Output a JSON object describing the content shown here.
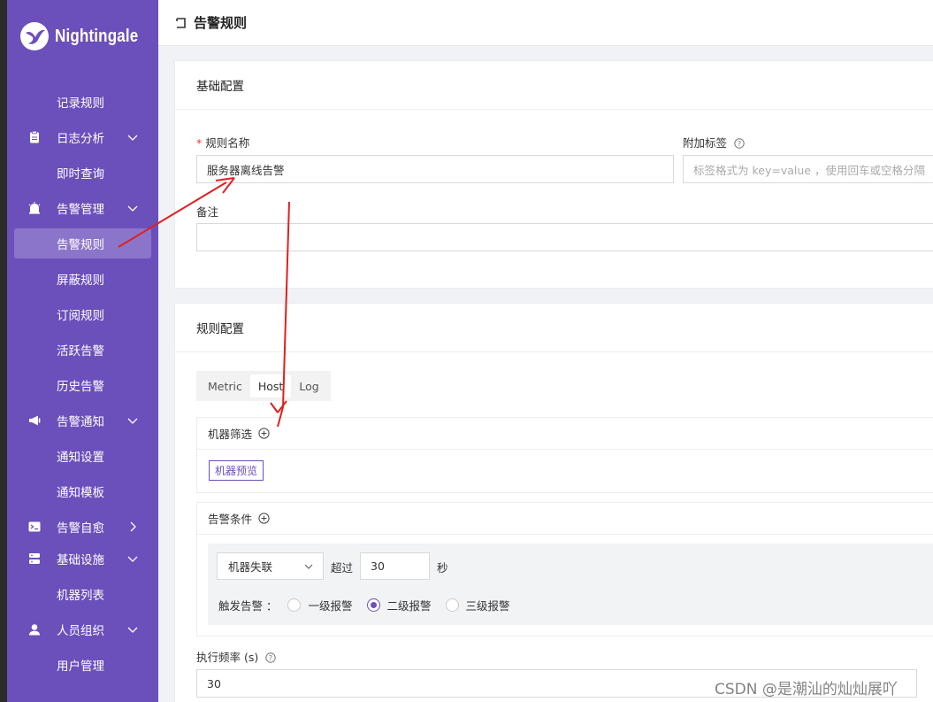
{
  "brand": {
    "name": "Nightingale"
  },
  "sidebar": {
    "items": [
      {
        "label": "记录规则",
        "kind": "child"
      },
      {
        "label": "日志分析",
        "kind": "group",
        "icon": "clipboard-icon",
        "caret": "down"
      },
      {
        "label": "即时查询",
        "kind": "child"
      },
      {
        "label": "告警管理",
        "kind": "group",
        "icon": "alarm-bell-icon",
        "caret": "down"
      },
      {
        "label": "告警规则",
        "kind": "child",
        "active": true
      },
      {
        "label": "屏蔽规则",
        "kind": "child"
      },
      {
        "label": "订阅规则",
        "kind": "child"
      },
      {
        "label": "活跃告警",
        "kind": "child"
      },
      {
        "label": "历史告警",
        "kind": "child"
      },
      {
        "label": "告警通知",
        "kind": "group",
        "icon": "megaphone-icon",
        "caret": "down"
      },
      {
        "label": "通知设置",
        "kind": "child"
      },
      {
        "label": "通知模板",
        "kind": "child"
      },
      {
        "label": "告警自愈",
        "kind": "group",
        "icon": "terminal-icon",
        "caret": "right"
      },
      {
        "label": "基础设施",
        "kind": "group",
        "icon": "server-icon",
        "caret": "down"
      },
      {
        "label": "机器列表",
        "kind": "child"
      },
      {
        "label": "人员组织",
        "kind": "group",
        "icon": "user-icon",
        "caret": "down"
      },
      {
        "label": "用户管理",
        "kind": "child"
      }
    ]
  },
  "header": {
    "title": "告警规则"
  },
  "basic": {
    "section_title": "基础配置",
    "rule_name_label": "规则名称",
    "rule_name_value": "服务器离线告警",
    "tags_label": "附加标签",
    "tags_placeholder": "标签格式为 key=value ，使用回车或空格分隔",
    "note_label": "备注",
    "note_value": ""
  },
  "rule": {
    "section_title": "规则配置",
    "tabs": [
      {
        "label": "Metric"
      },
      {
        "label": "Host",
        "active": true
      },
      {
        "label": "Log"
      }
    ],
    "machine_filter_label": "机器筛选",
    "machine_preview_button": "机器预览",
    "alert_condition_label": "告警条件",
    "condition_select_value": "机器失联",
    "exceed_label": "超过",
    "exceed_value": "30",
    "seconds_unit": "秒",
    "trigger_label": "触发告警 ：",
    "severity_options": [
      {
        "label": "一级报警",
        "checked": false
      },
      {
        "label": "二级报警",
        "checked": true
      },
      {
        "label": "三级报警",
        "checked": false
      }
    ],
    "frequency_label": "执行频率 (s)",
    "frequency_value": "30"
  },
  "watermark": "CSDN @是潮汕的灿灿展吖",
  "colors": {
    "brand_purple": "#6b4fbb",
    "annotation_red": "#e02020"
  }
}
